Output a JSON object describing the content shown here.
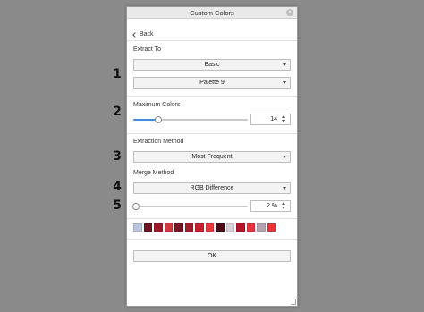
{
  "dialog": {
    "title": "Custom Colors",
    "back_label": "Back",
    "extract_to_label": "Extract To",
    "extract_to_value": "Basic",
    "palette_value": "Palette 9",
    "max_colors_label": "Maximum Colors",
    "max_colors_value": "14",
    "max_colors_slider_fraction": 0.22,
    "extraction_method_label": "Extraction Method",
    "extraction_method_value": "Most Frequent",
    "merge_method_label": "Merge Method",
    "merge_method_value": "RGB Difference",
    "merge_percent_value": "2 %",
    "merge_slider_fraction": 0.02,
    "swatches": [
      "#b7c6dc",
      "#6b1622",
      "#9b1b2b",
      "#d03a42",
      "#7a1524",
      "#a31e2d",
      "#c8202e",
      "#e33a3f",
      "#4a0c17",
      "#d8d0d8",
      "#b5152a",
      "#e23540",
      "#b5a2b1",
      "#ea3438"
    ],
    "ok_label": "OK"
  },
  "step_numbers": [
    "1",
    "2",
    "3",
    "4",
    "5"
  ]
}
